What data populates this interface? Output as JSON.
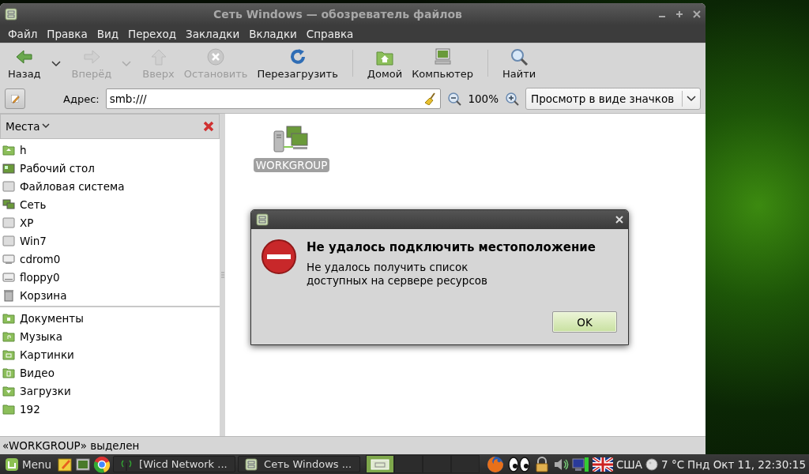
{
  "window": {
    "title": "Сеть Windows — обозреватель файлов"
  },
  "menu": [
    {
      "label": "Файл"
    },
    {
      "label": "Правка"
    },
    {
      "label": "Вид"
    },
    {
      "label": "Переход"
    },
    {
      "label": "Закладки"
    },
    {
      "label": "Вкладки"
    },
    {
      "label": "Справка"
    }
  ],
  "toolbar": [
    {
      "kind": "button",
      "label": "Назад",
      "disabled": false,
      "dropdown": true
    },
    {
      "kind": "button",
      "label": "Вперёд",
      "disabled": true,
      "dropdown": true
    },
    {
      "kind": "button",
      "label": "Вверх",
      "disabled": true,
      "dropdown": false
    },
    {
      "kind": "button",
      "label": "Остановить",
      "disabled": true,
      "dropdown": false
    },
    {
      "kind": "button",
      "label": "Перезагрузить",
      "disabled": false,
      "dropdown": false
    },
    {
      "kind": "separator"
    },
    {
      "kind": "button",
      "label": "Домой",
      "disabled": false,
      "dropdown": false
    },
    {
      "kind": "button",
      "label": "Компьютер",
      "disabled": false,
      "dropdown": false
    },
    {
      "kind": "separator"
    },
    {
      "kind": "button",
      "label": "Найти",
      "disabled": false,
      "dropdown": false
    }
  ],
  "location_bar": {
    "label": "Адрес:",
    "value": "smb:///",
    "zoom": "100%",
    "view_mode": "Просмотр в виде значков"
  },
  "sidebar": {
    "title": "Места",
    "groups": [
      [
        {
          "label": "h"
        },
        {
          "label": "Рабочий стол"
        },
        {
          "label": "Файловая система"
        },
        {
          "label": "Сеть"
        },
        {
          "label": "XP"
        },
        {
          "label": "Win7"
        },
        {
          "label": "cdrom0"
        },
        {
          "label": "floppy0"
        },
        {
          "label": "Корзина"
        }
      ],
      [
        {
          "label": "Документы"
        },
        {
          "label": "Музыка"
        },
        {
          "label": "Картинки"
        },
        {
          "label": "Видео"
        },
        {
          "label": "Загрузки"
        },
        {
          "label": "192"
        }
      ]
    ]
  },
  "content": {
    "items": [
      {
        "label": "WORKGROUP",
        "selected": true
      }
    ]
  },
  "status_bar": "«WORKGROUP» выделен",
  "dialog": {
    "heading": "Не удалось подключить местоположение",
    "message": "Не удалось получить список\nдоступных на сервере ресурсов",
    "button": "OK"
  },
  "taskbar": {
    "menu": "Menu",
    "tasks": [
      {
        "label": "[Wicd Network ...",
        "selected": false
      },
      {
        "label": "Сеть Windows ...",
        "selected": false
      }
    ],
    "workspaces": [
      {
        "selected": true
      },
      {
        "selected": false
      },
      {
        "selected": false
      },
      {
        "selected": false
      }
    ],
    "keyboard": "США",
    "weather": "7 °C",
    "clock": "Пнд Окт 11, 22:30:15"
  }
}
